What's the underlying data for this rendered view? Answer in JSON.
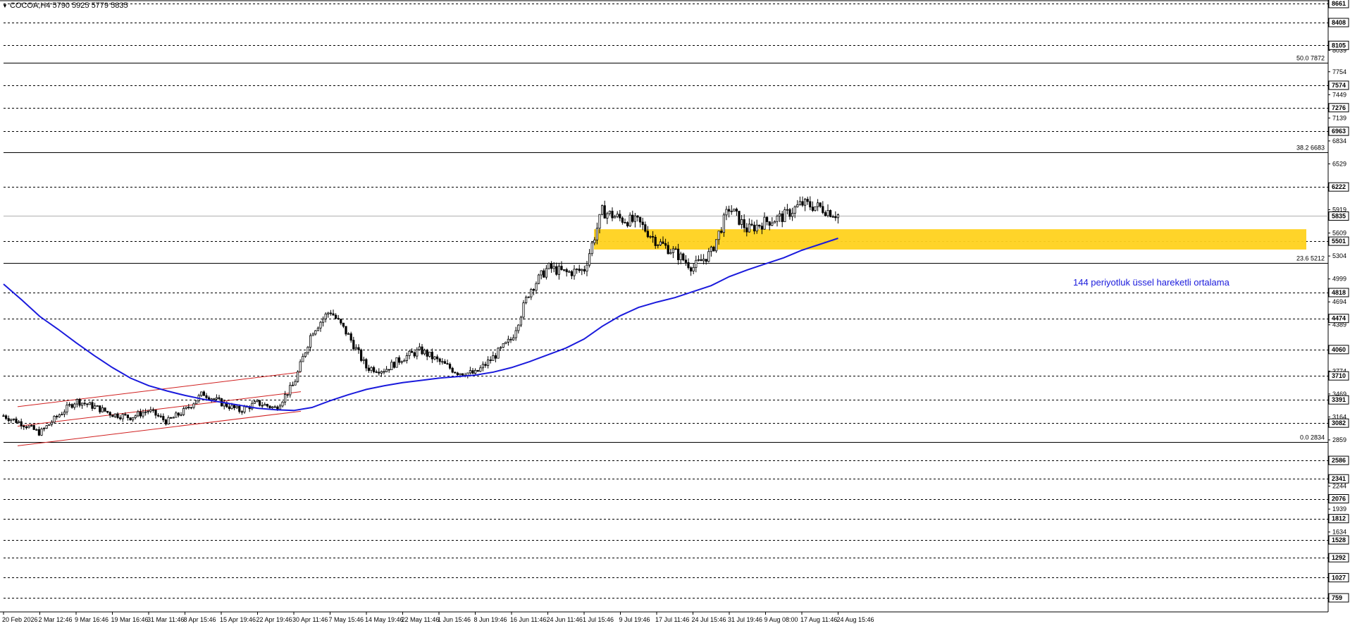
{
  "header": {
    "symbol": "COCOA,H4",
    "ohlc": "5790 5925 5779 5835"
  },
  "annotation": "144 periyotluk üssel hareketli ortalama",
  "colors": {
    "candle": "#000000",
    "ma": "#1a1adc",
    "channel": "#d02020",
    "zone": "#ffd21e",
    "fib": "#000000",
    "grid": "#000000",
    "price_line": "#b0b0b0"
  },
  "chart_data": {
    "type": "candlestick",
    "symbol": "COCOA",
    "timeframe": "H4",
    "y_axis": {
      "range": [
        759,
        8661
      ],
      "boxed_ticks": [
        8661,
        8408,
        8105,
        7574,
        7276,
        6963,
        6222,
        5835,
        5501,
        4818,
        4474,
        4060,
        3710,
        3391,
        3082,
        2586,
        2341,
        2076,
        1812,
        1528,
        1292,
        1027,
        759
      ],
      "plain_ticks": [
        8039,
        7754,
        7449,
        7139,
        6834,
        6529,
        5919,
        5609,
        5304,
        4999,
        4694,
        4389,
        3774,
        3469,
        3164,
        2859,
        2244,
        1939,
        1634
      ]
    },
    "dashed_levels": [
      8661,
      8408,
      8105,
      7574,
      7276,
      6963,
      6222,
      5501,
      4818,
      4474,
      4060,
      3710,
      3391,
      3082,
      2586,
      2341,
      2076,
      1812,
      1528,
      1292,
      1027,
      759
    ],
    "current_price": 5835,
    "fibonacci": [
      {
        "label": "50.0",
        "value": 7872
      },
      {
        "label": "38.2",
        "value": 6683
      },
      {
        "label": "23.6",
        "value": 5212
      },
      {
        "label": "0.0",
        "value": 2834
      }
    ],
    "x_labels": [
      "20 Feb 2026",
      "2 Mar 12:46",
      "9 Mar 16:46",
      "19 Mar 16:46",
      "31 Mar 11:46",
      "8 Apr 15:46",
      "15 Apr 19:46",
      "22 Apr 19:46",
      "30 Apr 11:46",
      "7 May 15:46",
      "14 May 19:46",
      "22 May 11:46",
      "1 Jun 15:46",
      "8 Jun 19:46",
      "16 Jun 11:46",
      "24 Jun 11:46",
      "1 Jul 15:46",
      "9 Jul 19:46",
      "17 Jul 11:46",
      "24 Jul 15:46",
      "31 Jul 19:46",
      "9 Aug 08:00",
      "17 Aug 11:46",
      "24 Aug 15:46"
    ],
    "price_path": [
      [
        "20 Feb 2026",
        3180
      ],
      [
        "",
        3080
      ],
      [
        "2 Mar 12:46",
        2950
      ],
      [
        "",
        3180
      ],
      [
        "9 Mar 16:46",
        3380
      ],
      [
        "",
        3300
      ],
      [
        "19 Mar 16:46",
        3200
      ],
      [
        "",
        3160
      ],
      [
        "31 Mar 11:46",
        3250
      ],
      [
        "",
        3100
      ],
      [
        "8 Apr 15:46",
        3250
      ],
      [
        "",
        3480
      ],
      [
        "15 Apr 19:46",
        3350
      ],
      [
        "",
        3250
      ],
      [
        "22 Apr 19:46",
        3350
      ],
      [
        "",
        3280
      ],
      [
        "30 Apr 11:46",
        3600
      ],
      [
        "",
        4300
      ],
      [
        "7 May 15:46",
        4580
      ],
      [
        "",
        4250
      ],
      [
        "14 May 19:46",
        3820
      ],
      [
        "",
        3790
      ],
      [
        "22 May 11:46",
        3950
      ],
      [
        "",
        4050
      ],
      [
        "1 Jun 15:46",
        3900
      ],
      [
        "",
        3760
      ],
      [
        "8 Jun 19:46",
        3740
      ],
      [
        "",
        3960
      ],
      [
        "16 Jun 11:46",
        4200
      ],
      [
        "",
        4850
      ],
      [
        "24 Jun 11:46",
        5150
      ],
      [
        "",
        5080
      ],
      [
        "1 Jul 15:46",
        5120
      ],
      [
        "",
        5900
      ],
      [
        "9 Jul 19:46",
        5800
      ],
      [
        "",
        5750
      ],
      [
        "17 Jul 11:46",
        5500
      ],
      [
        "",
        5350
      ],
      [
        "24 Jul 15:46",
        5150
      ],
      [
        "",
        5350
      ],
      [
        "31 Jul 19:46",
        5950
      ],
      [
        "",
        5650
      ],
      [
        "9 Aug 08:00",
        5760
      ],
      [
        "",
        5830
      ],
      [
        "17 Aug 11:46",
        6000
      ],
      [
        "",
        5950
      ],
      [
        "24 Aug 15:46",
        5850
      ]
    ],
    "ema_144": [
      [
        "20 Feb 2026",
        4930
      ],
      [
        "",
        4720
      ],
      [
        "2 Mar 12:46",
        4500
      ],
      [
        "",
        4330
      ],
      [
        "9 Mar 16:46",
        4150
      ],
      [
        "",
        3980
      ],
      [
        "19 Mar 16:46",
        3820
      ],
      [
        "",
        3680
      ],
      [
        "31 Mar 11:46",
        3580
      ],
      [
        "",
        3510
      ],
      [
        "8 Apr 15:46",
        3450
      ],
      [
        "",
        3400
      ],
      [
        "15 Apr 19:46",
        3360
      ],
      [
        "",
        3320
      ],
      [
        "22 Apr 19:46",
        3280
      ],
      [
        "",
        3260
      ],
      [
        "30 Apr 11:46",
        3250
      ],
      [
        "",
        3290
      ],
      [
        "7 May 15:46",
        3380
      ],
      [
        "",
        3460
      ],
      [
        "14 May 19:46",
        3530
      ],
      [
        "",
        3580
      ],
      [
        "22 May 11:46",
        3620
      ],
      [
        "",
        3650
      ],
      [
        "1 Jun 15:46",
        3680
      ],
      [
        "",
        3700
      ],
      [
        "8 Jun 19:46",
        3720
      ],
      [
        "",
        3760
      ],
      [
        "16 Jun 11:46",
        3820
      ],
      [
        "",
        3900
      ],
      [
        "24 Jun 11:46",
        3990
      ],
      [
        "",
        4080
      ],
      [
        "1 Jul 15:46",
        4200
      ],
      [
        "",
        4370
      ],
      [
        "9 Jul 19:46",
        4510
      ],
      [
        "",
        4620
      ],
      [
        "17 Jul 11:46",
        4690
      ],
      [
        "",
        4750
      ],
      [
        "24 Jul 15:46",
        4830
      ],
      [
        "",
        4910
      ],
      [
        "31 Jul 19:46",
        5030
      ],
      [
        "",
        5120
      ],
      [
        "9 Aug 08:00",
        5200
      ],
      [
        "",
        5280
      ],
      [
        "17 Aug 11:46",
        5380
      ],
      [
        "",
        5460
      ],
      [
        "24 Aug 15:46",
        5540
      ]
    ],
    "channel": {
      "upper": [
        [
          "20 Feb 2026",
          3300
        ],
        [
          "30 Apr 11:46",
          3760
        ]
      ],
      "middle": [
        [
          "20 Feb 2026",
          3040
        ],
        [
          "30 Apr 11:46",
          3500
        ]
      ],
      "lower": [
        [
          "20 Feb 2026",
          2780
        ],
        [
          "30 Apr 11:46",
          3240
        ]
      ]
    },
    "support_zone": {
      "low": 5390,
      "high": 5660,
      "from": "1 Jul 15:46"
    }
  }
}
